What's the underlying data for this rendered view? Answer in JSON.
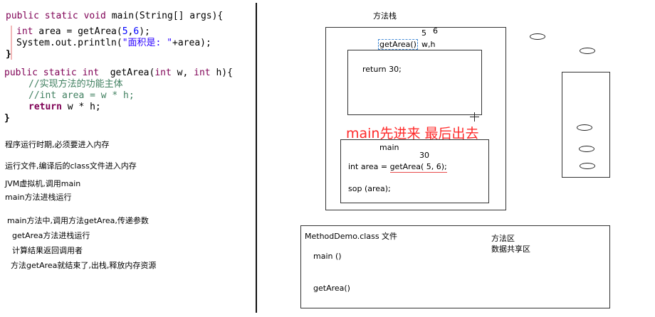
{
  "code": {
    "main_sig": {
      "kw": "public static void ",
      "name": "main",
      "params": "(String[] args){"
    },
    "line_area": {
      "kw": "int",
      "rest": " area = getArea(",
      "n1": "5",
      "comma": ",",
      "n2": "6",
      "close": ");"
    },
    "line_print": {
      "pre": "System.out.println(",
      "str": "\"面积是: \"",
      "post": "+area);"
    },
    "close1": "}",
    "getarea_sig": {
      "kw": "public static int  ",
      "name": "getArea",
      "params_a": "(",
      "kw_int1": "int",
      "params_b": " w, ",
      "kw_int2": "int",
      "params_c": " h){"
    },
    "comment1": "//实现方法的功能主体",
    "comment2": "//int area = w * h;",
    "ret_kw": "return",
    "ret_rest": " w * h;",
    "close2": "}"
  },
  "notes": [
    "程序运行时期,必须要进入内存",
    "运行文件,编译后的class文件进入内存",
    "JVM虚拟机,调用main",
    "main方法进栈运行",
    "main方法中,调用方法getArea,传递参数",
    "getArea方法进栈运行",
    "计算结果返回调用者",
    "方法getArea就结束了,出栈,释放内存资源"
  ],
  "stack": {
    "title": "方法栈",
    "arg5": "5",
    "arg6": "6",
    "getarea_label": "getArea()",
    "params_label": "w,h",
    "return_text": "return  30;",
    "red_caption": "main先进来 最后出去",
    "main_label": "main",
    "result": "30",
    "main_line_pre": "int area = ",
    "main_line_call": "getArea( 5, 6);",
    "sop_line": "sop (area);"
  },
  "method_area": {
    "file_label": "MethodDemo.class 文件",
    "area_title": "方法区",
    "area_sub": "数据共享区",
    "main_item": "main ()",
    "getarea_item": "getArea()"
  },
  "colors": {
    "caption_red": "#ff2a2a",
    "underline_red": "#e84a4a",
    "keyword": "#7f0055",
    "number": "#0000ff",
    "comment": "#3f7f5f",
    "dashed_blue": "#4a8fd8"
  }
}
